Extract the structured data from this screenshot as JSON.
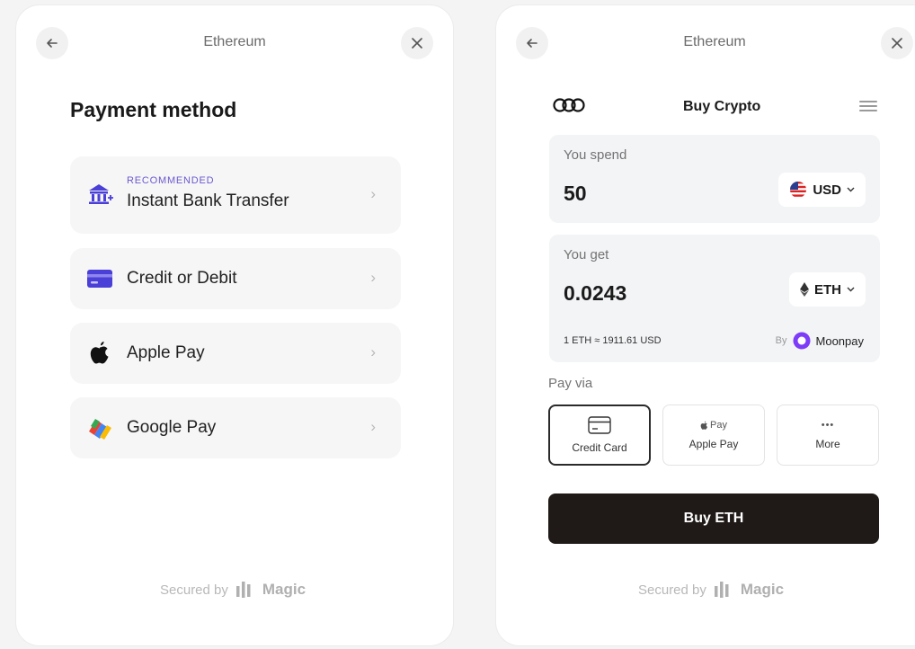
{
  "left_panel": {
    "header_title": "Ethereum",
    "back_icon": "arrow-left-icon",
    "close_icon": "close-icon",
    "title": "Payment method",
    "methods": [
      {
        "tag": "RECOMMENDED",
        "label": "Instant Bank Transfer",
        "icon": "bank-icon"
      },
      {
        "tag": "",
        "label": "Credit or Debit",
        "icon": "credit-card-icon"
      },
      {
        "tag": "",
        "label": "Apple Pay",
        "icon": "apple-icon"
      },
      {
        "tag": "",
        "label": "Google Pay",
        "icon": "google-pay-icon"
      }
    ],
    "secured_by": "Secured by",
    "secured_brand": "Magic"
  },
  "right_panel": {
    "header_title": "Ethereum",
    "title": "Buy Crypto",
    "spend": {
      "label": "You spend",
      "amount": "50",
      "currency": "USD"
    },
    "get": {
      "label": "You get",
      "amount": "0.0243",
      "currency": "ETH"
    },
    "rate": "1 ETH ≈ 1911.61 USD",
    "provider_prefix": "By",
    "provider": "Moonpay",
    "pay_via_label": "Pay via",
    "pay_options": [
      {
        "label": "Credit Card",
        "icon": "credit-card-icon",
        "selected": true
      },
      {
        "label": "Apple Pay",
        "icon": "apple-pay-icon",
        "selected": false
      },
      {
        "label": "More",
        "icon": "more-icon",
        "selected": false
      }
    ],
    "apple_pay_glyph": "Pay",
    "more_glyph": "•••",
    "buy_button": "Buy ETH",
    "secured_by": "Secured by",
    "secured_brand": "Magic"
  },
  "colors": {
    "accent": "#6a5acd",
    "buy_button": "#1f1a17",
    "moonpay": "#7d3cf8"
  }
}
